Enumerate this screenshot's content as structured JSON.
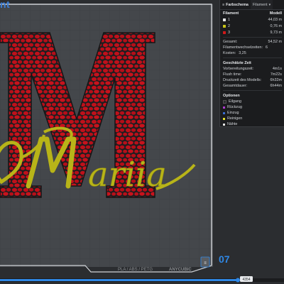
{
  "viewport": {
    "corner_text": "nt",
    "layer_number": "07",
    "model_text": "Mariia",
    "model_letter": "M",
    "plate_label": "PLA / ABS / PETG",
    "plate_brand": "ANYCUBIC",
    "slider_value": "4354",
    "colors": {
      "red": "#c0101a",
      "dark": "#262628",
      "yellow": "#b8b418",
      "accent": "#2f88e6"
    }
  },
  "panel": {
    "tab_color_scheme": "Farbschema",
    "tab_filament": "Filament",
    "header_filament": "Filament",
    "header_model": "Modell",
    "filaments": [
      {
        "id": "1",
        "value": "44,03 m",
        "color": "#e6e6e6"
      },
      {
        "id": "2",
        "value": "0,76 m",
        "color": "#c8c41a"
      },
      {
        "id": "3",
        "value": "9,73 m",
        "color": "#d01a1a"
      }
    ],
    "total_label": "Gesamt:",
    "total_value": "54,52 m",
    "changes_label": "Filamentwechselzeiten:",
    "changes_value": "6",
    "cost_label": "Kosten:",
    "cost_value": "3,25",
    "time_section": "Geschätzte Zeit",
    "prep_label": "Vorbereitungszeit:",
    "prep_value": "4m1s",
    "flush_label": "Flush time:",
    "flush_value": "7m22s",
    "print_label": "Druckzeit des Modells:",
    "print_value": "6h32m",
    "total_time_label": "Gesamtdauer:",
    "total_time_value": "6h44m",
    "options_section": "Optionen",
    "options": [
      {
        "label": "Eilgang",
        "color": "#2a2c2f"
      },
      {
        "label": "Rückzug",
        "color": "#b43bd6"
      },
      {
        "label": "Einzug",
        "color": "#3b6fd6"
      },
      {
        "label": "Reinigen",
        "color": "#e6e22a"
      },
      {
        "label": "Nähte",
        "color": "#e8e8e8"
      }
    ]
  }
}
